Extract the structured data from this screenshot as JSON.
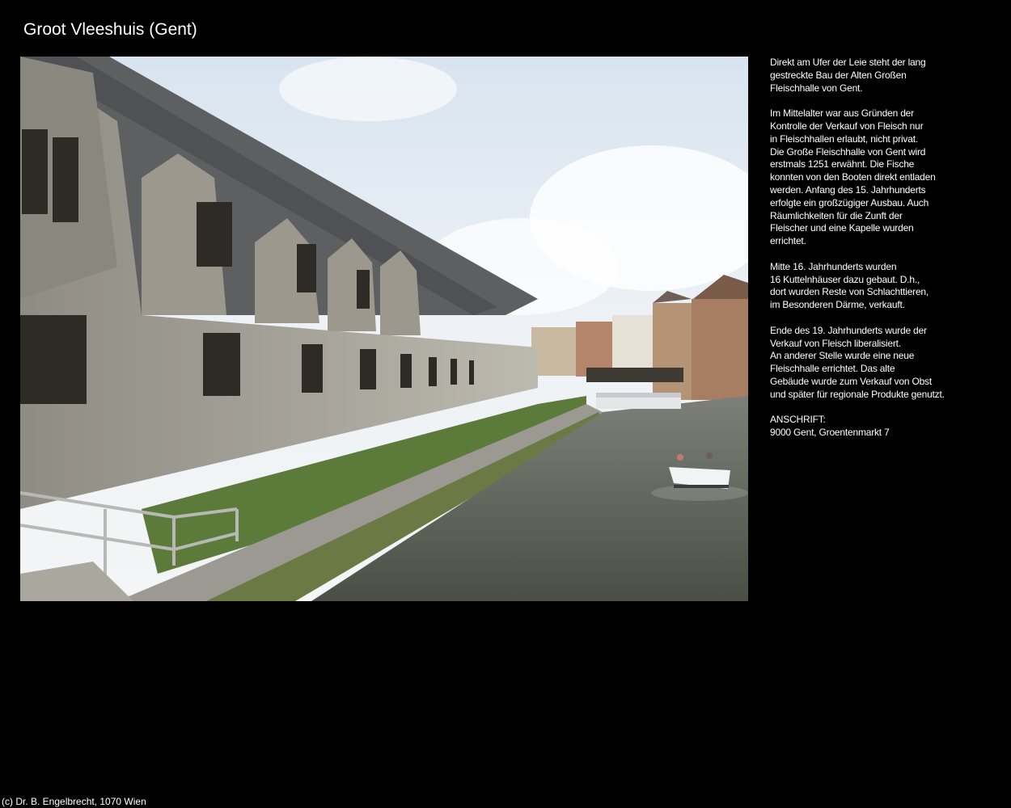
{
  "title": "Groot Vleeshuis (Gent)",
  "description": {
    "paragraphs": [
      "Direkt am Ufer der Leie steht der lang\ngestreckte Bau der Alten Großen\nFleischhalle von Gent.",
      "Im Mittelalter war aus Gründen der\nKontrolle der Verkauf von Fleisch nur\nin Fleischhallen erlaubt, nicht privat.\nDie Große Fleischhalle von Gent wird\nerstmals 1251 erwähnt. Die Fische\nkonnten von den Booten direkt entladen\nwerden. Anfang des 15. Jahrhunderts\nerfolgte ein großzügiger Ausbau. Auch\nRäumlichkeiten für die Zunft der\nFleischer und eine Kapelle wurden\nerrichtet.",
      "Mitte 16. Jahrhunderts wurden\n16 Kuttelnhäuser dazu gebaut. D.h.,\ndort wurden Reste von Schlachttieren,\nim Besonderen Därme, verkauft.",
      "Ende des 19. Jahrhunderts wurde der\nVerkauf von Fleisch liberalisiert.\nAn anderer Stelle wurde eine neue\nFleischhalle errichtet. Das alte\nGebäude wurde zum Verkauf von Obst\nund später für regionale Produkte genutzt."
    ],
    "address": "ANSCHRIFT:\n9000 Gent, Groentenmarkt 7"
  },
  "footer": "(c) Dr. B. Engelbrecht, 1070 Wien"
}
